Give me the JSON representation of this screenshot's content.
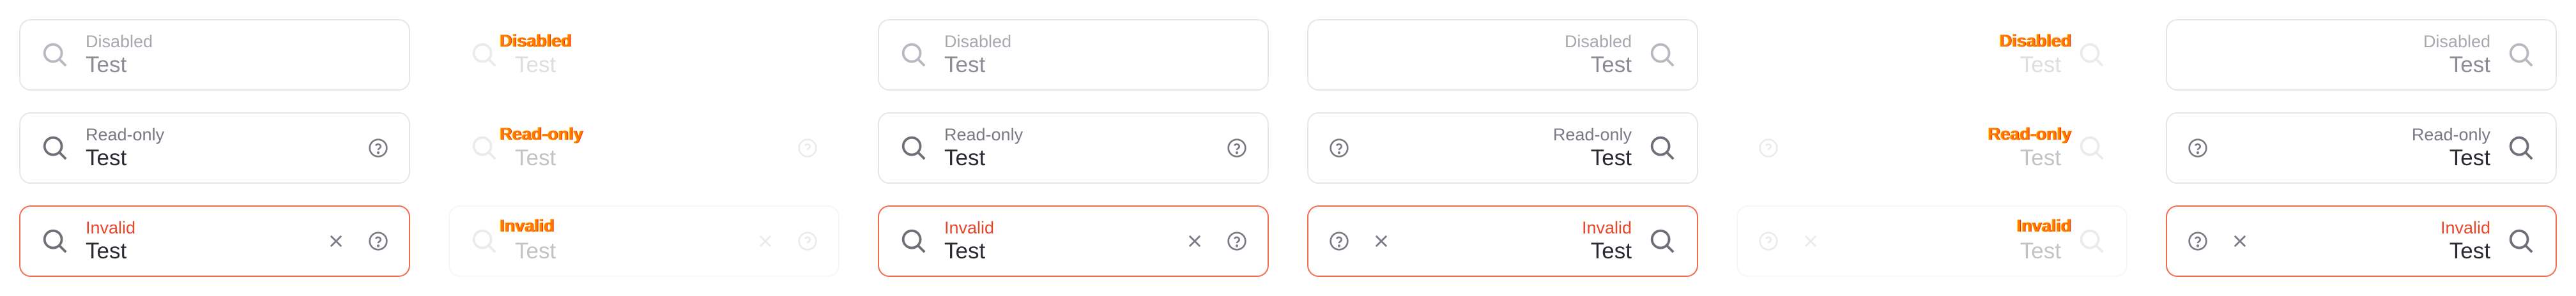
{
  "fields": {
    "disabled": {
      "label": "Disabled",
      "value": "Test"
    },
    "readonly": {
      "label": "Read-only",
      "value": "Test"
    },
    "invalid": {
      "label": "Invalid",
      "value": "Test"
    }
  },
  "icons": {
    "search": "search-icon",
    "help": "help-icon",
    "clear": "clear-icon"
  },
  "colors": {
    "border": "#e6e6ea",
    "invalid_border": "#ef6b4e",
    "invalid_label": "#e8482a",
    "glitch": "#ff7a00"
  }
}
